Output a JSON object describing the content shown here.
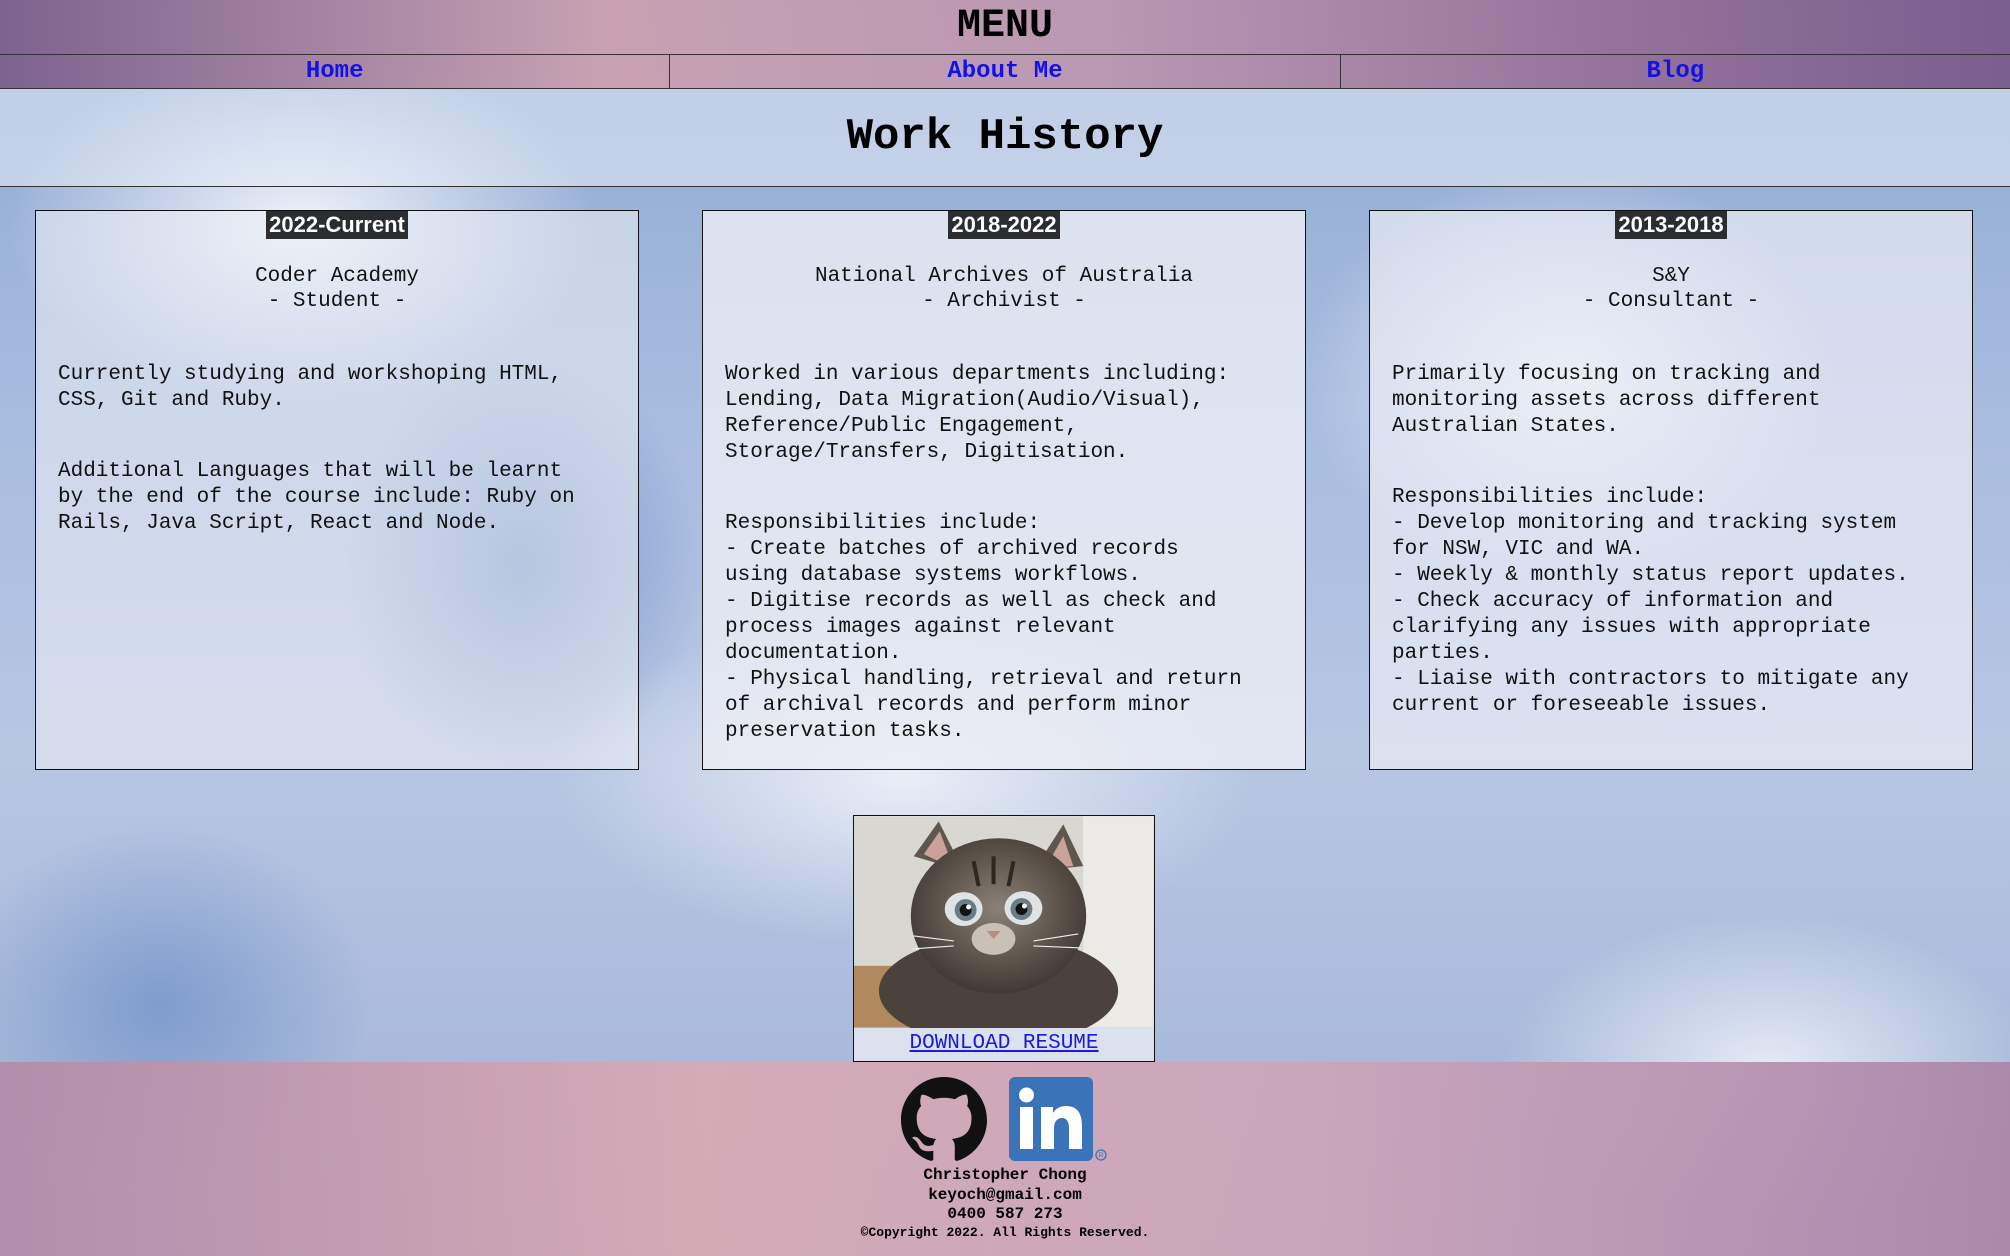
{
  "header": {
    "menu_title": "MENU",
    "nav": [
      {
        "label": "Home"
      },
      {
        "label": "About Me"
      },
      {
        "label": "Blog"
      }
    ]
  },
  "page": {
    "title": "Work History"
  },
  "jobs": [
    {
      "period": "2022-Current",
      "organisation": "Coder Academy",
      "role": "- Student -",
      "paragraphs": [
        "Currently studying and workshoping HTML,\nCSS, Git and Ruby.",
        "Additional Languages that will be learnt\nby the end of the course include: Ruby on\nRails, Java Script, React and Node."
      ]
    },
    {
      "period": "2018-2022",
      "organisation": "National Archives of Australia",
      "role": "- Archivist -",
      "paragraphs": [
        "Worked in various departments including:\nLending, Data Migration(Audio/Visual),\nReference/Public Engagement,\nStorage/Transfers, Digitisation.",
        "Responsibilities include:\n- Create batches of archived records\nusing database systems workflows.\n- Digitise records as well as check and\nprocess images against relevant\ndocumentation.\n- Physical handling, retrieval and return\nof archival records and perform minor\npreservation tasks."
      ]
    },
    {
      "period": "2013-2018",
      "organisation": "S&Y",
      "role": "- Consultant -",
      "paragraphs": [
        "Primarily focusing on tracking and\nmonitoring assets across different\nAustralian States.",
        "Responsibilities include:\n- Develop monitoring and tracking system\nfor NSW, VIC and WA.\n- Weekly & monthly status report updates.\n- Check accuracy of information and\nclarifying any issues with appropriate\nparties.\n- Liaise with contractors to mitigate any\ncurrent or foreseeable issues."
      ]
    }
  ],
  "resume": {
    "image": "kitten-photo",
    "link_label": "DOWNLOAD RESUME"
  },
  "footer": {
    "icons": [
      "github-icon",
      "linkedin-icon"
    ],
    "name": "Christopher Chong",
    "email": "keyoch@gmail.com",
    "phone": "0400 587 273",
    "copyright": "©Copyright 2022. All Rights Reserved."
  },
  "colors": {
    "nav_link": "#1212e6",
    "badge_bg": "#2b2d30",
    "linkedin_blue": "#3b73b9"
  }
}
